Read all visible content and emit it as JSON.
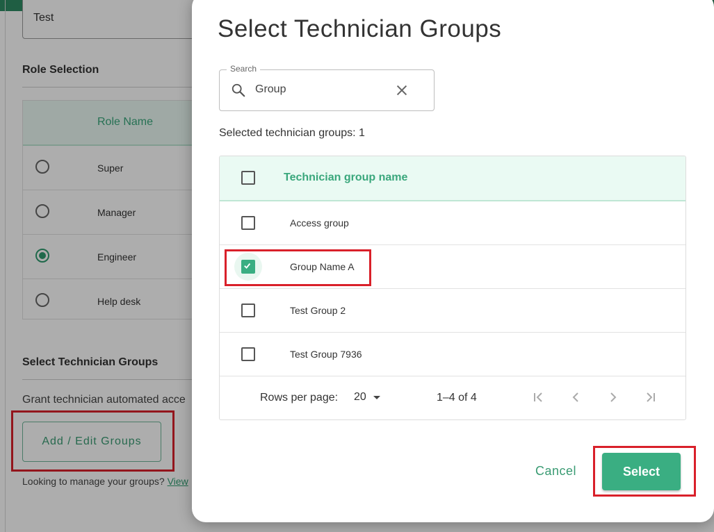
{
  "background": {
    "name_field_value": "Test",
    "role_section_title": "Role Selection",
    "role_table_header": "Role Name",
    "roles": [
      {
        "label": "Super",
        "selected": false
      },
      {
        "label": "Manager",
        "selected": false
      },
      {
        "label": "Engineer",
        "selected": true
      },
      {
        "label": "Help desk",
        "selected": false
      }
    ],
    "groups_section_title": "Select Technician Groups",
    "grant_text": "Grant technician automated acce",
    "add_edit_label": "Add / Edit Groups",
    "looking_text": "Looking to manage your groups?",
    "view_link": "View"
  },
  "dialog": {
    "title": "Select Technician Groups",
    "search": {
      "label": "Search",
      "value": "Group"
    },
    "selected_count_text": "Selected technician groups: 1",
    "table": {
      "header": "Technician group name",
      "rows": [
        {
          "label": "Access group",
          "checked": false
        },
        {
          "label": "Group Name A",
          "checked": true
        },
        {
          "label": "Test Group 2",
          "checked": false
        },
        {
          "label": "Test Group 7936",
          "checked": false
        }
      ]
    },
    "pagination": {
      "rows_per_page_label": "Rows per page:",
      "rows_per_page_value": "20",
      "range_text": "1–4 of 4"
    },
    "cancel_label": "Cancel",
    "select_label": "Select"
  },
  "colors": {
    "accent": "#3aae82",
    "header_bg": "#eafaf3",
    "highlight": "#d9202a"
  }
}
